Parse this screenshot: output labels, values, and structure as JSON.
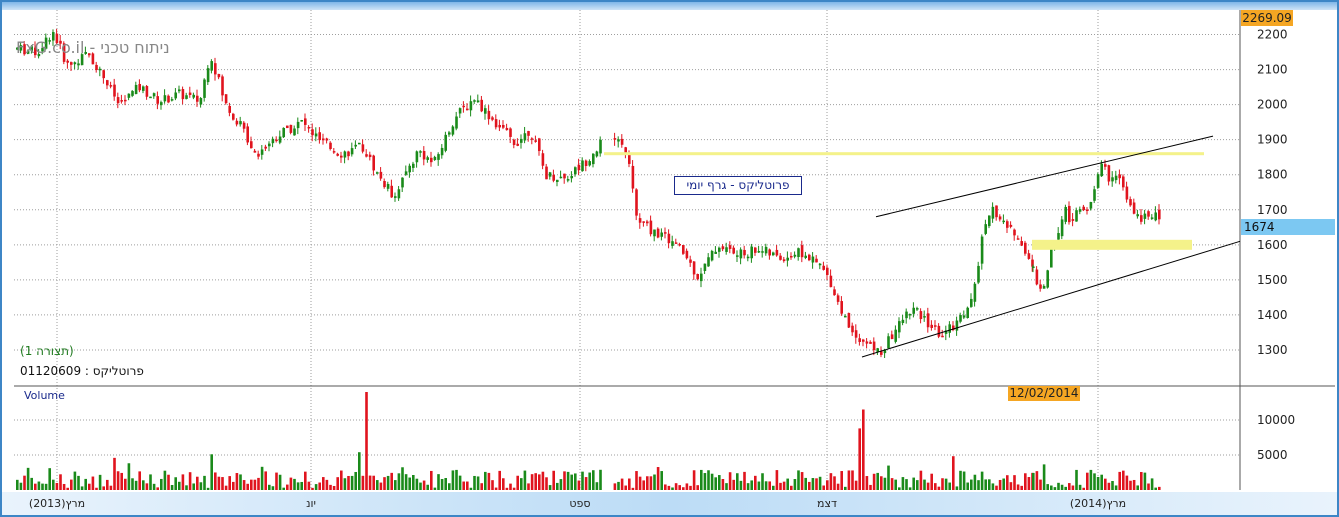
{
  "header": {
    "logo_text": "FxG.co.il - ניתוח טכני",
    "chart_title": "פרוטליקס - גרף יומי",
    "view_label": "(תצורה 1)",
    "symbol_label": "01120609 : פרוטליקס",
    "volume_label": "Volume",
    "max_price_tag": "2269.09",
    "last_price_tag": "1674",
    "date_tag": "12/02/2014"
  },
  "colors": {
    "up": "#1a8a1a",
    "down": "#e0141e",
    "grid": "#9e9e9e",
    "trendline": "#000000",
    "highlight": "#f4f28a",
    "accent": "#f5a623",
    "last_price_bg": "#7cc8f2"
  },
  "chart_data": {
    "type": "candlestick",
    "title": "פרוטליקס - גרף יומי",
    "price_axis": {
      "ticks": [
        "2200",
        "2100",
        "2000",
        "1900",
        "1800",
        "1700",
        "1600",
        "1500",
        "1400",
        "1300"
      ],
      "range": [
        1200,
        2270
      ]
    },
    "volume_axis": {
      "ticks": [
        "10000",
        "5000"
      ],
      "range": [
        0,
        14000
      ]
    },
    "x_axis": {
      "labels": [
        "מרץ(2013)",
        "יונ",
        "ספט",
        "דצמ",
        "מרץ(2014)"
      ]
    },
    "price_path": [
      {
        "t": 0,
        "p": 2160
      },
      {
        "t": 0.02,
        "p": 2150
      },
      {
        "t": 0.035,
        "p": 2210
      },
      {
        "t": 0.05,
        "p": 2110
      },
      {
        "t": 0.07,
        "p": 2145
      },
      {
        "t": 0.085,
        "p": 2080
      },
      {
        "t": 0.1,
        "p": 2000
      },
      {
        "t": 0.12,
        "p": 2050
      },
      {
        "t": 0.14,
        "p": 2010
      },
      {
        "t": 0.16,
        "p": 2030
      },
      {
        "t": 0.18,
        "p": 2010
      },
      {
        "t": 0.19,
        "p": 2150
      },
      {
        "t": 0.205,
        "p": 2000
      },
      {
        "t": 0.22,
        "p": 1940
      },
      {
        "t": 0.235,
        "p": 1860
      },
      {
        "t": 0.26,
        "p": 1920
      },
      {
        "t": 0.28,
        "p": 1950
      },
      {
        "t": 0.3,
        "p": 1890
      },
      {
        "t": 0.32,
        "p": 1860
      },
      {
        "t": 0.34,
        "p": 1880
      },
      {
        "t": 0.355,
        "p": 1800
      },
      {
        "t": 0.37,
        "p": 1740
      },
      {
        "t": 0.38,
        "p": 1790
      },
      {
        "t": 0.395,
        "p": 1870
      },
      {
        "t": 0.41,
        "p": 1830
      },
      {
        "t": 0.43,
        "p": 1960
      },
      {
        "t": 0.45,
        "p": 2020
      },
      {
        "t": 0.47,
        "p": 1950
      },
      {
        "t": 0.49,
        "p": 1890
      },
      {
        "t": 0.505,
        "p": 1930
      },
      {
        "t": 0.52,
        "p": 1800
      },
      {
        "t": 0.54,
        "p": 1790
      },
      {
        "t": 0.56,
        "p": 1840
      },
      {
        "t": 0.58,
        "p": 1910
      },
      {
        "t": 0.6,
        "p": 1870
      },
      {
        "t": 0.61,
        "p": 1670
      },
      {
        "t": 0.625,
        "p": 1640
      },
      {
        "t": 0.64,
        "p": 1620
      },
      {
        "t": 0.655,
        "p": 1580
      },
      {
        "t": 0.67,
        "p": 1510
      },
      {
        "t": 0.69,
        "p": 1600
      },
      {
        "t": 0.71,
        "p": 1570
      },
      {
        "t": 0.73,
        "p": 1590
      },
      {
        "t": 0.75,
        "p": 1560
      },
      {
        "t": 0.77,
        "p": 1580
      },
      {
        "t": 0.79,
        "p": 1540
      },
      {
        "t": 0.8,
        "p": 1500
      },
      {
        "t": 0.81,
        "p": 1420
      },
      {
        "t": 0.82,
        "p": 1360
      },
      {
        "t": 0.835,
        "p": 1320
      },
      {
        "t": 0.85,
        "p": 1290
      },
      {
        "t": 0.865,
        "p": 1360
      },
      {
        "t": 0.88,
        "p": 1420
      },
      {
        "t": 0.895,
        "p": 1380
      },
      {
        "t": 0.91,
        "p": 1340
      },
      {
        "t": 0.925,
        "p": 1380
      },
      {
        "t": 0.94,
        "p": 1440
      },
      {
        "t": 0.95,
        "p": 1620
      },
      {
        "t": 0.96,
        "p": 1700
      },
      {
        "t": 0.975,
        "p": 1650
      },
      {
        "t": 0.99,
        "p": 1600
      },
      {
        "t": 1.0,
        "p": 1530
      }
    ],
    "price_path_2": [
      {
        "t": 0,
        "p": 1530
      },
      {
        "t": 0.05,
        "p": 1460
      },
      {
        "t": 0.1,
        "p": 1500
      },
      {
        "t": 0.15,
        "p": 1600
      },
      {
        "t": 0.2,
        "p": 1640
      },
      {
        "t": 0.25,
        "p": 1700
      },
      {
        "t": 0.3,
        "p": 1670
      },
      {
        "t": 0.35,
        "p": 1700
      },
      {
        "t": 0.4,
        "p": 1690
      },
      {
        "t": 0.45,
        "p": 1720
      },
      {
        "t": 0.5,
        "p": 1780
      },
      {
        "t": 0.55,
        "p": 1830
      },
      {
        "t": 0.6,
        "p": 1790
      },
      {
        "t": 0.65,
        "p": 1810
      },
      {
        "t": 0.7,
        "p": 1780
      },
      {
        "t": 0.75,
        "p": 1720
      },
      {
        "t": 0.8,
        "p": 1680
      }
    ]
  }
}
